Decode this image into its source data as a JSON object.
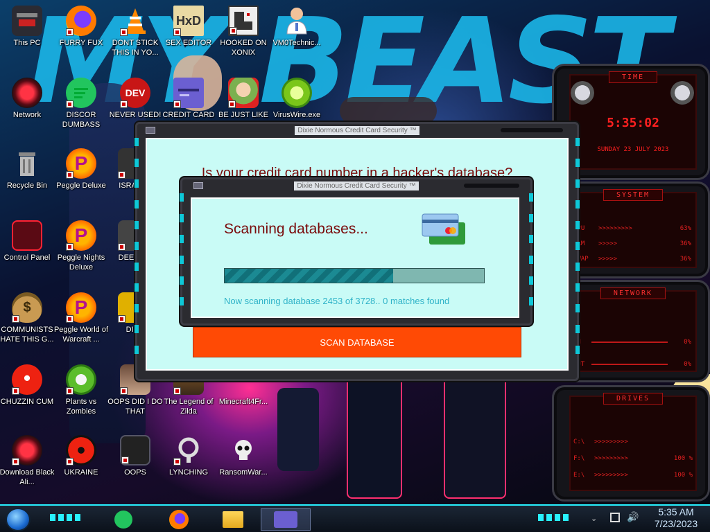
{
  "desktop": {
    "banner": "MY BEAST",
    "icons": [
      {
        "label": "This PC"
      },
      {
        "label": "FURRY FUX"
      },
      {
        "label": "DONT STICK THIS IN YO..."
      },
      {
        "label": "SEX EDITOR"
      },
      {
        "label": "HOOKED ON XONIX"
      },
      {
        "label": "VM0Technic..."
      },
      {
        "label": "Network"
      },
      {
        "label": "DISCOR DUMBASS"
      },
      {
        "label": "NEVER USED!"
      },
      {
        "label": "CREDIT CARD"
      },
      {
        "label": "BE JUST LIKE"
      },
      {
        "label": "VirusWire.exe"
      },
      {
        "label": "Recycle Bin"
      },
      {
        "label": "Peggle Deluxe"
      },
      {
        "label": "ISRAI"
      },
      {
        "label": "Control Panel"
      },
      {
        "label": "Peggle Nights Deluxe"
      },
      {
        "label": "DEEZ"
      },
      {
        "label": "COMMUNISTS HATE THIS G..."
      },
      {
        "label": "Peggle World of Warcraft ..."
      },
      {
        "label": "DIE"
      },
      {
        "label": "CHUZZIN CUM"
      },
      {
        "label": "Plants vs Zombies"
      },
      {
        "label": "OOPS DID I DO THAT"
      },
      {
        "label": "The Legend of Zilda"
      },
      {
        "label": "Minecraft4Fr..."
      },
      {
        "label": "Download Black Ali..."
      },
      {
        "label": "UKRAINE"
      },
      {
        "label": "OOPS"
      },
      {
        "label": "LYNCHING"
      },
      {
        "label": "RansomWar..."
      }
    ]
  },
  "gadgets": {
    "time": {
      "header": "TIME",
      "clock": "5:35:02",
      "date": "SUNDAY 23 JULY 2023"
    },
    "system": {
      "header": "SYSTEM",
      "rows": [
        {
          "label": "CPU",
          "value": "63%"
        },
        {
          "label": "RAM",
          "value": "36%"
        },
        {
          "label": "SWAP",
          "value": "36%"
        }
      ]
    },
    "network": {
      "header": "NETWORK",
      "rows": [
        {
          "label": "IN",
          "value": "0%"
        },
        {
          "label": "OUT",
          "value": "0%"
        }
      ]
    },
    "drives": {
      "header": "DRIVES",
      "rows": [
        {
          "label": "C:\\",
          "value": ""
        },
        {
          "label": "F:\\",
          "value": "100 %"
        },
        {
          "label": "E:\\",
          "value": "100 %"
        }
      ]
    }
  },
  "main_window": {
    "title": "Dixie Normous Credit Card Security ™",
    "question": "Is your credit card number in a hacker's database?",
    "scan_button": "SCAN DATABASE"
  },
  "scan_dialog": {
    "title": "Dixie Normous Credit Card Security ™",
    "heading": "Scanning databases...",
    "progress": 0.65,
    "status": "Now scanning database 2453 of 3728.. 0 matches found"
  },
  "taskbar": {
    "time": "5:35 AM",
    "date": "7/23/2023"
  },
  "colors": {
    "accent": "#28f0ff",
    "scan_button": "#ff4a05",
    "heading": "#7a0b0b",
    "status_text": "#2fb3c8"
  }
}
